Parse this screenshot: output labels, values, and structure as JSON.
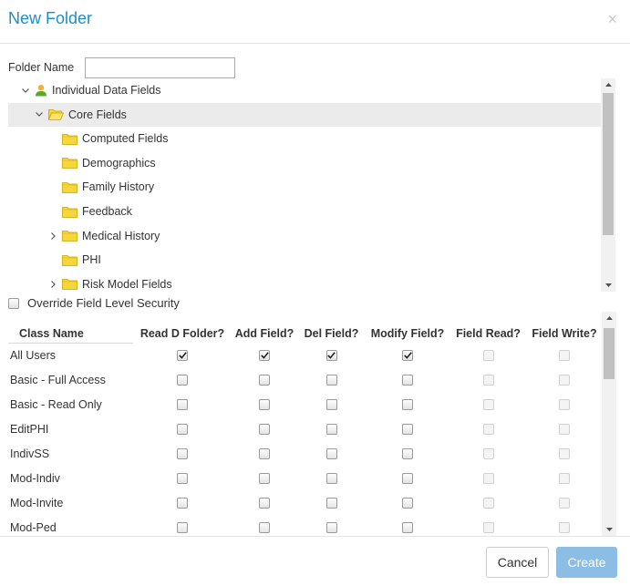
{
  "dialog": {
    "title": "New Folder",
    "close_glyph": "×"
  },
  "folder_name": {
    "label": "Folder Name",
    "value": "",
    "placeholder": ""
  },
  "tree": {
    "items": [
      {
        "label": "Individual Data Fields",
        "icon": "user-icon",
        "expander": "expanded",
        "level": 0,
        "selected": false
      },
      {
        "label": "Core Fields",
        "icon": "folder-open-icon",
        "expander": "expanded",
        "level": 1,
        "selected": true
      },
      {
        "label": "Computed Fields",
        "icon": "folder-icon",
        "expander": "none",
        "level": 2,
        "selected": false
      },
      {
        "label": "Demographics",
        "icon": "folder-icon",
        "expander": "none",
        "level": 2,
        "selected": false
      },
      {
        "label": "Family History",
        "icon": "folder-icon",
        "expander": "none",
        "level": 2,
        "selected": false
      },
      {
        "label": "Feedback",
        "icon": "folder-icon",
        "expander": "none",
        "level": 2,
        "selected": false
      },
      {
        "label": "Medical History",
        "icon": "folder-icon",
        "expander": "collapsed",
        "level": 2,
        "selected": false
      },
      {
        "label": "PHI",
        "icon": "folder-icon",
        "expander": "none",
        "level": 2,
        "selected": false
      },
      {
        "label": "Risk Model Fields",
        "icon": "folder-icon",
        "expander": "collapsed",
        "level": 2,
        "selected": false
      }
    ]
  },
  "override": {
    "label": "Override Field Level Security",
    "checked": false
  },
  "permissions": {
    "columns": [
      "Class Name",
      "Read D Folder?",
      "Add Field?",
      "Del Field?",
      "Modify Field?",
      "Field Read?",
      "Field Write?"
    ],
    "rows": [
      {
        "name": "All Users",
        "values": [
          true,
          true,
          true,
          true,
          false,
          false
        ],
        "disabled": [
          false,
          false,
          false,
          false,
          true,
          true
        ]
      },
      {
        "name": "Basic - Full Access",
        "values": [
          false,
          false,
          false,
          false,
          false,
          false
        ],
        "disabled": [
          false,
          false,
          false,
          false,
          true,
          true
        ]
      },
      {
        "name": "Basic - Read Only",
        "values": [
          false,
          false,
          false,
          false,
          false,
          false
        ],
        "disabled": [
          false,
          false,
          false,
          false,
          true,
          true
        ]
      },
      {
        "name": "EditPHI",
        "values": [
          false,
          false,
          false,
          false,
          false,
          false
        ],
        "disabled": [
          false,
          false,
          false,
          false,
          true,
          true
        ]
      },
      {
        "name": "IndivSS",
        "values": [
          false,
          false,
          false,
          false,
          false,
          false
        ],
        "disabled": [
          false,
          false,
          false,
          false,
          true,
          true
        ]
      },
      {
        "name": "Mod-Indiv",
        "values": [
          false,
          false,
          false,
          false,
          false,
          false
        ],
        "disabled": [
          false,
          false,
          false,
          false,
          true,
          true
        ]
      },
      {
        "name": "Mod-Invite",
        "values": [
          false,
          false,
          false,
          false,
          false,
          false
        ],
        "disabled": [
          false,
          false,
          false,
          false,
          true,
          true
        ]
      },
      {
        "name": "Mod-Ped",
        "values": [
          false,
          false,
          false,
          false,
          false,
          false
        ],
        "disabled": [
          false,
          false,
          false,
          false,
          true,
          true
        ]
      }
    ]
  },
  "footer": {
    "cancel_label": "Cancel",
    "create_label": "Create"
  },
  "colors": {
    "title": "#1a8fc9",
    "selected_row": "#ebebeb",
    "folder": "#f7d63b",
    "create_button": "#8cbde4"
  }
}
